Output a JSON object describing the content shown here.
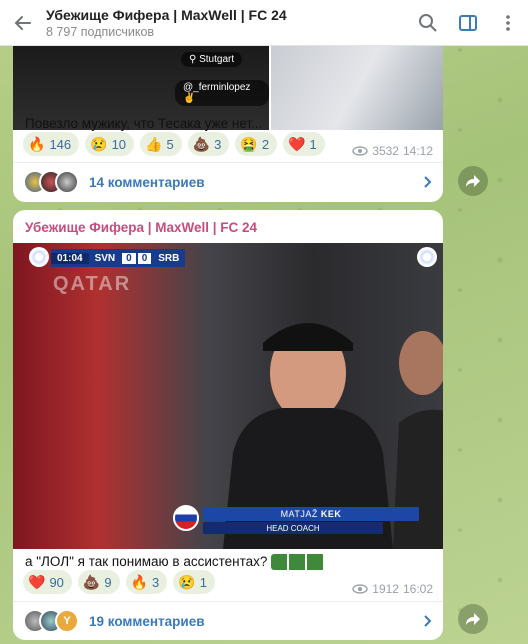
{
  "header": {
    "title": "Убежище Фифера | MaxWell | FC 24",
    "subtitle": "8 797 подписчиков"
  },
  "post1": {
    "location_tag": "Stutgart",
    "handle_tag": "@_ferminlopez",
    "text": "Повезло мужику, что Тесака уже нет...",
    "reactions": [
      {
        "emoji": "🔥",
        "count": "146"
      },
      {
        "emoji": "😢",
        "count": "10"
      },
      {
        "emoji": "👍",
        "count": "5"
      },
      {
        "emoji": "💩",
        "count": "3"
      },
      {
        "emoji": "🤮",
        "count": "2"
      },
      {
        "emoji": "❤️",
        "count": "1"
      }
    ],
    "views": "3532",
    "time": "14:12",
    "comments_label": "14 комментариев"
  },
  "post2": {
    "sender": "Убежище Фифера | MaxWell | FC 24",
    "video": {
      "clock": "01:04",
      "team1": "SVN",
      "score1": "0",
      "score2": "0",
      "team2": "SRB",
      "name_first": "MATJAŽ",
      "name_last": "KEK",
      "role": "HEAD COACH",
      "ad_text": "QATAR"
    },
    "text": "а \"ЛОЛ\" я так понимаю в ассистентах?",
    "reactions": [
      {
        "emoji": "❤️",
        "count": "90"
      },
      {
        "emoji": "💩",
        "count": "9"
      },
      {
        "emoji": "🔥",
        "count": "3"
      },
      {
        "emoji": "😢",
        "count": "1"
      }
    ],
    "views": "1912",
    "time": "16:02",
    "comments_label": "19 комментариев",
    "avatar_letter": "Y"
  },
  "colors": {
    "accent": "#3a7ab8",
    "sender": "#c44e7e"
  }
}
